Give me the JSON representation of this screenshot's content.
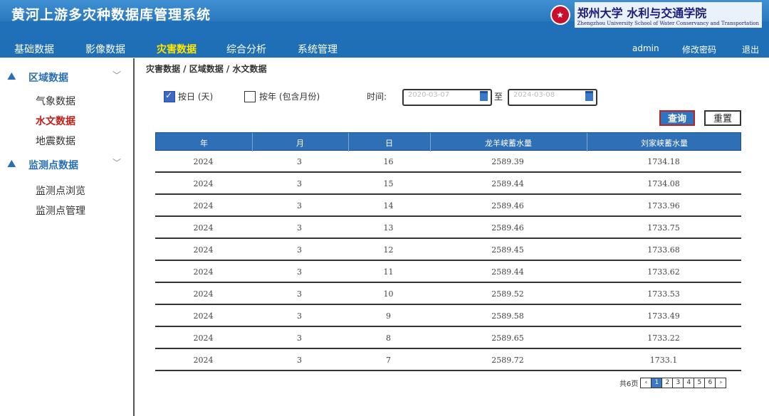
{
  "app": {
    "title": "黄河上游多灾种数据库管理系统",
    "logo_seal": "★",
    "logo_text": "郑州大学 水利与交通学院",
    "logo_sub": "Zhengzhou University  School of Water Conservancy and Transportation"
  },
  "nav": {
    "items": [
      "基础数据",
      "影像数据",
      "灾害数据",
      "综合分析",
      "系统管理"
    ],
    "active": "灾害数据",
    "user": "admin",
    "change_password": "修改密码",
    "logout": "退出"
  },
  "sidebar": {
    "groups": [
      {
        "label": "区域数据",
        "items": [
          "气象数据",
          "水文数据",
          "地震数据"
        ]
      },
      {
        "label": "监测点数据",
        "items": [
          "监测点浏览",
          "监测点管理"
        ]
      }
    ],
    "active_item": "水文数据",
    "group_icon": "mountain-icon",
    "chevron": "chevron-down-icon"
  },
  "breadcrumb": "灾害数据 / 区域数据 / 水文数据",
  "filters": {
    "daily_label": "按日 (天)",
    "daily_checked": true,
    "other_label": "按年 (包含月份)",
    "other_checked": false,
    "time_label": "时间:",
    "start_date": "2020-03-07",
    "separator": "至",
    "end_date": "2024-03-08"
  },
  "buttons": {
    "query": "查询",
    "reset": "重置"
  },
  "table": {
    "headers": [
      "年",
      "月",
      "日",
      "龙羊峡蓄水量",
      "刘家峡蓄水量"
    ],
    "rows": [
      [
        "2024",
        "3",
        "16",
        "2589.39",
        "1734.18"
      ],
      [
        "2024",
        "3",
        "15",
        "2589.44",
        "1734.08"
      ],
      [
        "2024",
        "3",
        "14",
        "2589.46",
        "1733.96"
      ],
      [
        "2024",
        "3",
        "13",
        "2589.46",
        "1733.75"
      ],
      [
        "2024",
        "3",
        "12",
        "2589.45",
        "1733.68"
      ],
      [
        "2024",
        "3",
        "11",
        "2589.44",
        "1733.62"
      ],
      [
        "2024",
        "3",
        "10",
        "2589.52",
        "1733.53"
      ],
      [
        "2024",
        "3",
        "9",
        "2589.58",
        "1733.49"
      ],
      [
        "2024",
        "3",
        "8",
        "2589.65",
        "1733.22"
      ],
      [
        "2024",
        "3",
        "7",
        "2589.72",
        "1733.1"
      ]
    ]
  },
  "pager": {
    "label": "共6页",
    "pages": [
      "1",
      "2",
      "3",
      "4",
      "5",
      "6"
    ],
    "prev": "‹",
    "next": "›",
    "current": "1"
  },
  "colors": {
    "header_blue": "#1f70b8",
    "active_nav": "#ffe600",
    "active_side": "#c0221b"
  }
}
